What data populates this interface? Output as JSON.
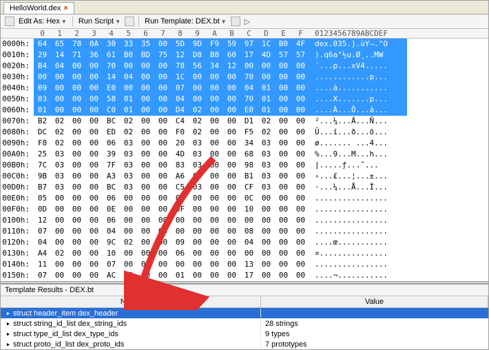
{
  "tab": {
    "title": "HelloWorld.dex"
  },
  "toolbar": {
    "editAs": "Edit As: Hex",
    "runScript": "Run Script",
    "runTemplate": "Run Template: DEX.bt"
  },
  "hexHeader": {
    "cols": [
      "0",
      "1",
      "2",
      "3",
      "4",
      "5",
      "6",
      "7",
      "8",
      "9",
      "A",
      "B",
      "C",
      "D",
      "E",
      "F"
    ],
    "ascii": "0123456789ABCDEF"
  },
  "highlightRows": 7,
  "rows": [
    {
      "addr": "0000h:",
      "b": [
        "64",
        "65",
        "78",
        "0A",
        "30",
        "33",
        "35",
        "00",
        "5D",
        "9D",
        "F9",
        "59",
        "97",
        "1C",
        "B0",
        "4F"
      ],
      "a": "dex.035.].ùY—.°O"
    },
    {
      "addr": "0010h:",
      "b": [
        "29",
        "14",
        "71",
        "36",
        "61",
        "B0",
        "BD",
        "75",
        "12",
        "D8",
        "B8",
        "60",
        "17",
        "4D",
        "57",
        "57"
      ],
      "a": ").q6a°½u.Ø¸..MW"
    },
    {
      "addr": "0020h:",
      "b": [
        "B4",
        "04",
        "00",
        "00",
        "70",
        "00",
        "00",
        "00",
        "78",
        "56",
        "34",
        "12",
        "00",
        "00",
        "00",
        "00"
      ],
      "a": "´...p...xV4....."
    },
    {
      "addr": "0030h:",
      "b": [
        "00",
        "00",
        "00",
        "00",
        "14",
        "04",
        "00",
        "00",
        "1C",
        "00",
        "00",
        "00",
        "70",
        "00",
        "00",
        "00"
      ],
      "a": "............p..."
    },
    {
      "addr": "0040h:",
      "b": [
        "09",
        "00",
        "00",
        "00",
        "E0",
        "00",
        "00",
        "00",
        "07",
        "00",
        "00",
        "00",
        "04",
        "01",
        "00",
        "00"
      ],
      "a": "....à..........."
    },
    {
      "addr": "0050h:",
      "b": [
        "03",
        "00",
        "00",
        "00",
        "58",
        "01",
        "00",
        "00",
        "04",
        "00",
        "00",
        "00",
        "70",
        "01",
        "00",
        "00"
      ],
      "a": "....X.......p..."
    },
    {
      "addr": "0060h:",
      "b": [
        "01",
        "00",
        "00",
        "00",
        "C0",
        "01",
        "00",
        "00",
        "D4",
        "02",
        "00",
        "00",
        "E0",
        "01",
        "00",
        "00"
      ],
      "a": "....À...Ô...à..."
    },
    {
      "addr": "0070h:",
      "b": [
        "B2",
        "02",
        "00",
        "00",
        "BC",
        "02",
        "00",
        "00",
        "C4",
        "02",
        "00",
        "00",
        "D1",
        "02",
        "00",
        "00"
      ],
      "a": "²...¼...Ä...Ñ..."
    },
    {
      "addr": "0080h:",
      "b": [
        "DC",
        "02",
        "00",
        "00",
        "ED",
        "02",
        "00",
        "00",
        "F0",
        "02",
        "00",
        "00",
        "F5",
        "02",
        "00",
        "00"
      ],
      "a": "Ü...í...ð...õ..."
    },
    {
      "addr": "0090h:",
      "b": [
        "F8",
        "02",
        "00",
        "00",
        "06",
        "03",
        "00",
        "00",
        "20",
        "03",
        "00",
        "00",
        "34",
        "03",
        "00",
        "00"
      ],
      "a": "ø....... ...4..."
    },
    {
      "addr": "00A0h:",
      "b": [
        "25",
        "03",
        "00",
        "00",
        "39",
        "03",
        "00",
        "00",
        "4D",
        "03",
        "00",
        "00",
        "68",
        "03",
        "00",
        "00"
      ],
      "a": "%...9...M...h..."
    },
    {
      "addr": "00B0h:",
      "b": [
        "7C",
        "03",
        "00",
        "00",
        "7F",
        "03",
        "00",
        "00",
        "83",
        "03",
        "00",
        "00",
        "98",
        "03",
        "00",
        "00"
      ],
      "a": "|.....ƒ...˜..."
    },
    {
      "addr": "00C0h:",
      "b": [
        "9B",
        "03",
        "00",
        "00",
        "A3",
        "03",
        "00",
        "00",
        "A6",
        "03",
        "00",
        "00",
        "B1",
        "03",
        "00",
        "00"
      ],
      "a": "›...£...¦...±..."
    },
    {
      "addr": "00D0h:",
      "b": [
        "B7",
        "03",
        "00",
        "00",
        "BC",
        "03",
        "00",
        "00",
        "C5",
        "03",
        "00",
        "00",
        "CF",
        "03",
        "00",
        "00"
      ],
      "a": "·...¼...Å...Ï..."
    },
    {
      "addr": "00E0h:",
      "b": [
        "05",
        "00",
        "00",
        "00",
        "06",
        "00",
        "00",
        "00",
        "0B",
        "00",
        "00",
        "00",
        "0C",
        "00",
        "00",
        "00"
      ],
      "a": "................"
    },
    {
      "addr": "00F0h:",
      "b": [
        "0D",
        "00",
        "00",
        "00",
        "0E",
        "00",
        "00",
        "00",
        "0F",
        "00",
        "00",
        "00",
        "10",
        "00",
        "00",
        "00"
      ],
      "a": "................"
    },
    {
      "addr": "0100h:",
      "b": [
        "12",
        "00",
        "00",
        "00",
        "06",
        "00",
        "00",
        "00",
        "00",
        "00",
        "00",
        "00",
        "00",
        "00",
        "00",
        "00"
      ],
      "a": "................"
    },
    {
      "addr": "0110h:",
      "b": [
        "07",
        "00",
        "00",
        "00",
        "04",
        "00",
        "00",
        "00",
        "00",
        "00",
        "00",
        "00",
        "08",
        "00",
        "00",
        "00"
      ],
      "a": "................"
    },
    {
      "addr": "0120h:",
      "b": [
        "04",
        "00",
        "00",
        "00",
        "9C",
        "02",
        "00",
        "00",
        "09",
        "00",
        "00",
        "00",
        "04",
        "00",
        "00",
        "00"
      ],
      "a": "....œ..........."
    },
    {
      "addr": "0130h:",
      "b": [
        "A4",
        "02",
        "00",
        "00",
        "10",
        "00",
        "00",
        "00",
        "06",
        "00",
        "00",
        "00",
        "00",
        "00",
        "00",
        "00"
      ],
      "a": "¤..............."
    },
    {
      "addr": "0140h:",
      "b": [
        "11",
        "00",
        "00",
        "00",
        "07",
        "00",
        "00",
        "00",
        "00",
        "00",
        "00",
        "00",
        "13",
        "00",
        "00",
        "00"
      ],
      "a": "................"
    },
    {
      "addr": "0150h:",
      "b": [
        "07",
        "00",
        "00",
        "00",
        "AC",
        "02",
        "00",
        "00",
        "01",
        "00",
        "00",
        "00",
        "17",
        "00",
        "00",
        "00"
      ],
      "a": "....¬..........."
    }
  ],
  "templateResults": {
    "title": "Template Results - DEX.bt",
    "headers": {
      "name": "Name",
      "value": "Value"
    },
    "rows": [
      {
        "name": "struct header_item dex_header",
        "value": "",
        "sel": true
      },
      {
        "name": "struct string_id_list dex_string_ids",
        "value": "28 strings",
        "sel": false
      },
      {
        "name": "struct type_id_list dex_type_ids",
        "value": "9 types",
        "sel": false
      },
      {
        "name": "struct proto_id_list dex_proto_ids",
        "value": "7 prototypes",
        "sel": false
      }
    ]
  }
}
